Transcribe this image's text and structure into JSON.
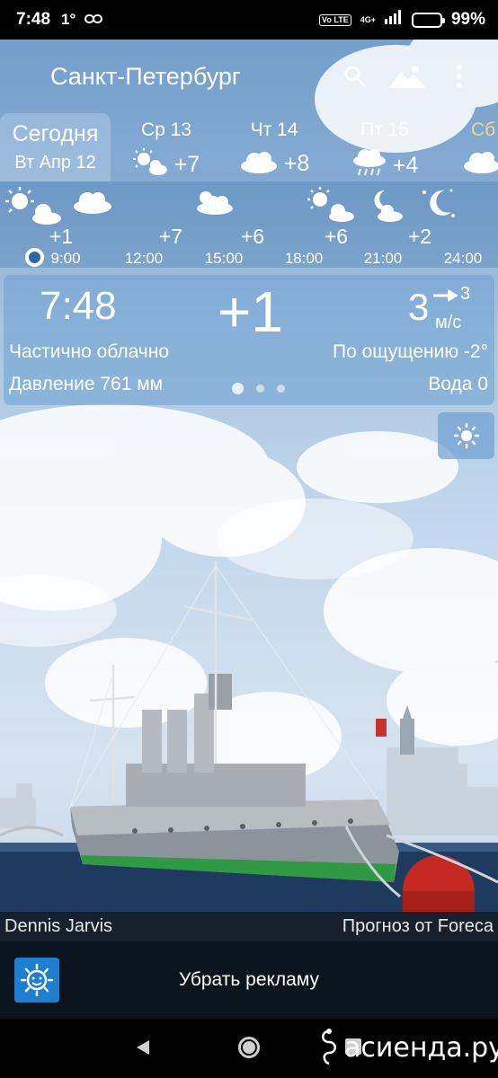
{
  "status_bar": {
    "time": "7:48",
    "temp_indicator": "1°",
    "volte": "Vo LTE",
    "network": "4G+",
    "battery": "99%"
  },
  "app_bar": {
    "city": "Санкт-Петербург",
    "icons": [
      "search-icon",
      "landscape-icon",
      "more-vert-icon"
    ]
  },
  "days": {
    "today": {
      "label": "Сегодня",
      "date": "Вт Апр 12"
    },
    "items": [
      {
        "label": "Ср 13",
        "temp": "+7",
        "icon": "partly-cloudy-icon"
      },
      {
        "label": "Чт 14",
        "temp": "+8",
        "icon": "cloud-icon"
      },
      {
        "label": "Пт 15",
        "temp": "+4",
        "icon": "rain-cloud-icon"
      },
      {
        "label": "Сб",
        "temp": "",
        "icon": "cloud-icon"
      }
    ]
  },
  "hourly": [
    {
      "time": "9:00",
      "temp": "+1",
      "icon": "partly-cloudy-icon"
    },
    {
      "time": "12:00",
      "temp": "+7",
      "icon": "cloud-icon"
    },
    {
      "time": "15:00",
      "temp": "+6",
      "icon": "cloud-sun-icon"
    },
    {
      "time": "18:00",
      "temp": "+6",
      "icon": "partly-cloudy-icon"
    },
    {
      "time": "21:00",
      "temp": "+2",
      "icon": "moon-cloud-icon"
    },
    {
      "time": "24:00",
      "temp": "",
      "icon": "moon-stars-icon"
    }
  ],
  "current": {
    "time": "7:48",
    "temp": "+1",
    "wind_speed": "3",
    "wind_gust": "3",
    "wind_unit": "м/с",
    "description": "Частично облачно",
    "feels_like": "По ощущению -2°",
    "pressure": "Давление 761 мм",
    "water": "Вода 0",
    "page": 1,
    "pages": 3
  },
  "credits": {
    "photo_author": "Dennis Jarvis",
    "provider": "Прогноз от Foreca"
  },
  "ad": {
    "remove_ads_label": "Убрать рекламу"
  },
  "watermark": "асиенда.ру",
  "colors": {
    "panel": "#6ea0d2",
    "saturday": "#f4d58a",
    "ad_bar": "#0b1520",
    "credits_bar": "#17212d",
    "ad_icon": "#1e7fd1"
  }
}
